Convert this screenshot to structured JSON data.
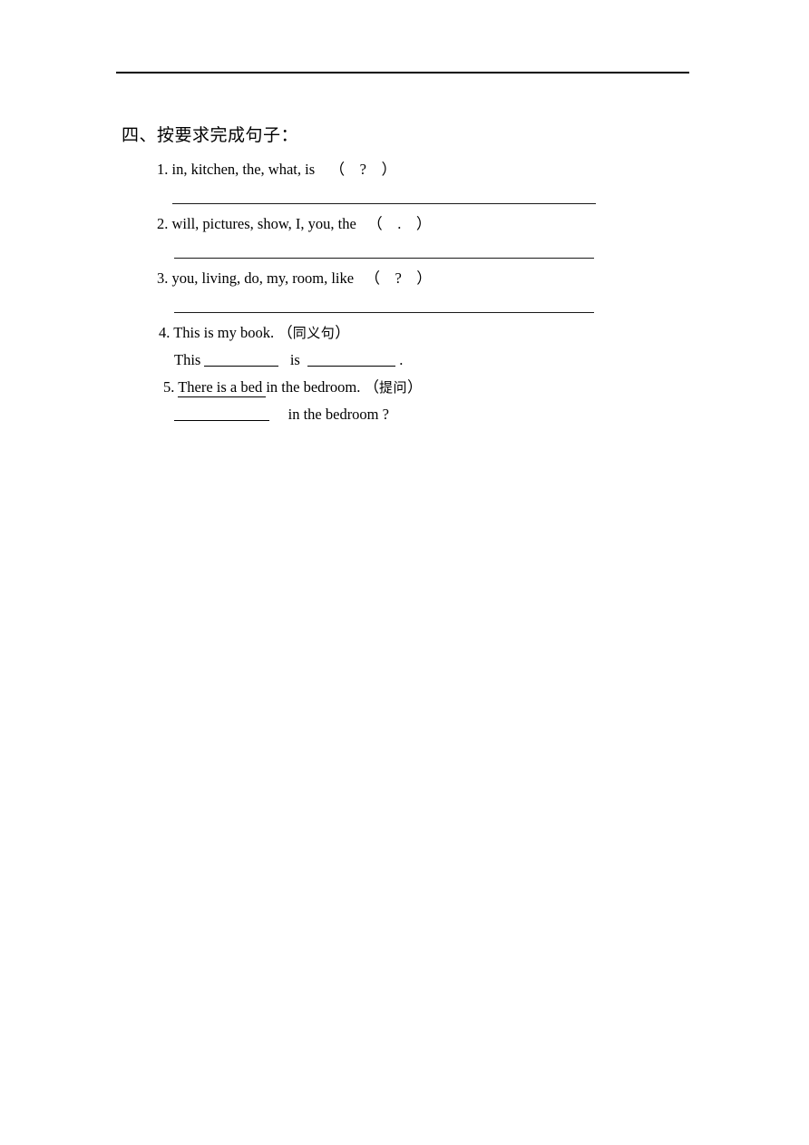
{
  "document": {
    "section_heading": "四、按要求完成句子：",
    "items": [
      {
        "number": "1.",
        "prompt": "in, kitchen, the, what, is",
        "hint": "（    ?    ）",
        "answer_line": true
      },
      {
        "number": "2.",
        "prompt": "will, pictures, show, I, you, the",
        "hint": "（    .    ）",
        "answer_line": true
      },
      {
        "number": "3.",
        "prompt": "you, living, do, my, room, like",
        "hint": "（    ?    ）",
        "answer_line": true
      },
      {
        "number": "4.",
        "prompt": "This is my book.",
        "hint_open": "（",
        "hint_cjk": "同义句",
        "hint_close": "）",
        "answer_prefix": "This",
        "answer_middle": "is",
        "answer_suffix": "."
      },
      {
        "number": "5.",
        "prompt_underlined": "There is a bed ",
        "prompt_rest": "in the bedroom.",
        "hint_open": "（",
        "hint_cjk": "提问",
        "hint_close": "）",
        "answer_suffix": "in the bedroom ?"
      }
    ]
  }
}
